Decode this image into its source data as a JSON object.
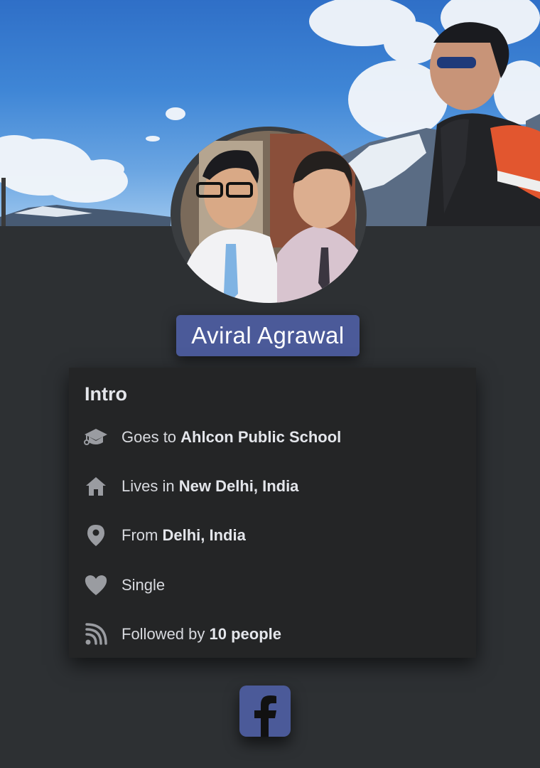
{
  "profile": {
    "name": "Aviral Agrawal"
  },
  "intro": {
    "title": "Intro",
    "items": [
      {
        "icon": "graduation-cap-icon",
        "prefix": "Goes to ",
        "value": "Ahlcon Public School"
      },
      {
        "icon": "home-icon",
        "prefix": "Lives in ",
        "value": "New Delhi, India"
      },
      {
        "icon": "location-pin-icon",
        "prefix": "From ",
        "value": "Delhi, India"
      },
      {
        "icon": "heart-icon",
        "prefix": "",
        "value": "Single"
      },
      {
        "icon": "rss-feed-icon",
        "prefix": "Followed by ",
        "value": "10 people"
      }
    ]
  },
  "colors": {
    "background": "#2d3033",
    "card": "#242526",
    "accent": "#4b5a99",
    "icon": "#9a9ca1"
  },
  "footer": {
    "logo": "facebook-logo-icon"
  }
}
